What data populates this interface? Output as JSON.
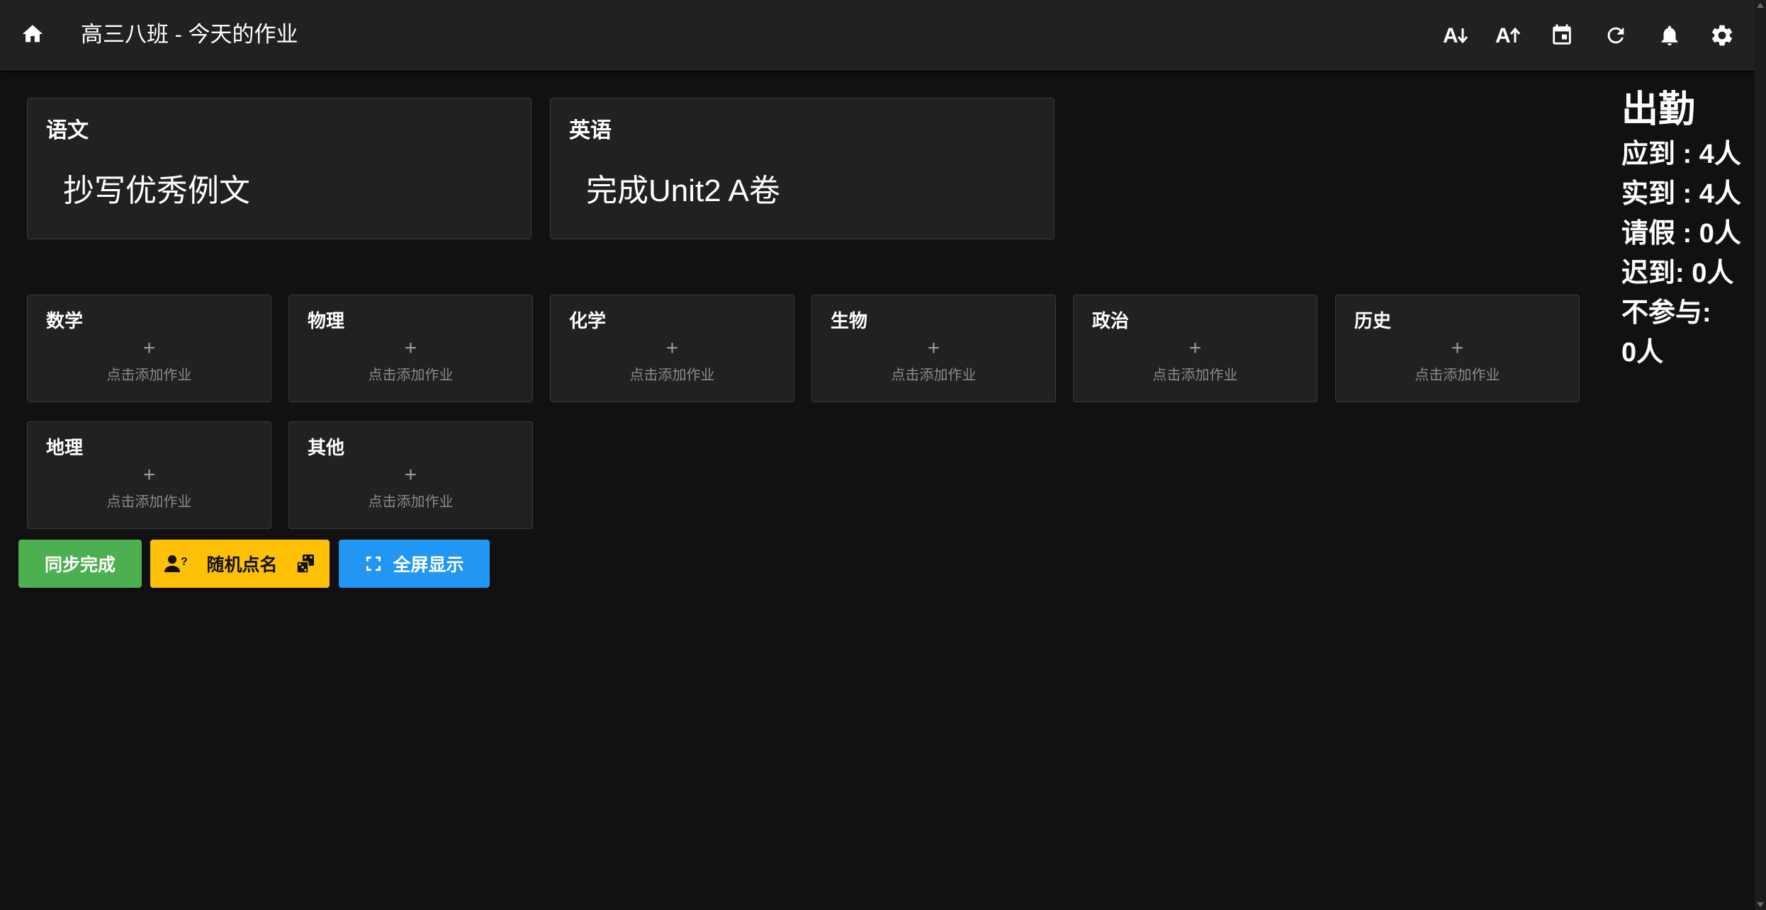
{
  "header": {
    "title": "高三八班 - 今天的作业",
    "icons": [
      "home-icon",
      "font-decrease-icon",
      "font-increase-icon",
      "calendar-icon",
      "refresh-icon",
      "bell-icon",
      "gear-icon"
    ],
    "decrease_label": "A",
    "increase_label": "A"
  },
  "assigned": [
    {
      "subject": "语文",
      "task": "抄写优秀例文"
    },
    {
      "subject": "英语",
      "task": "完成Unit2 A卷"
    }
  ],
  "unassigned": [
    {
      "subject": "数学",
      "plus": "+",
      "label": "点击添加作业"
    },
    {
      "subject": "物理",
      "plus": "+",
      "label": "点击添加作业"
    },
    {
      "subject": "化学",
      "plus": "+",
      "label": "点击添加作业"
    },
    {
      "subject": "生物",
      "plus": "+",
      "label": "点击添加作业"
    },
    {
      "subject": "政治",
      "plus": "+",
      "label": "点击添加作业"
    },
    {
      "subject": "历史",
      "plus": "+",
      "label": "点击添加作业"
    },
    {
      "subject": "地理",
      "plus": "+",
      "label": "点击添加作业"
    },
    {
      "subject": "其他",
      "plus": "+",
      "label": "点击添加作业"
    }
  ],
  "attendance": {
    "title": "出勤",
    "expected": "应到 : 4人",
    "actual": "实到 : 4人",
    "leave": "请假 : 0人",
    "late": "迟到: 0人",
    "absent_label": "不参与:",
    "absent_value": "0人"
  },
  "actions": {
    "sync_label": "同步完成",
    "random_label": "随机点名",
    "fullscreen_label": "全屏显示"
  },
  "colors": {
    "background": "#111111",
    "card": "#212121",
    "green": "#4caf50",
    "yellow": "#ffc107",
    "blue": "#2196f3"
  }
}
